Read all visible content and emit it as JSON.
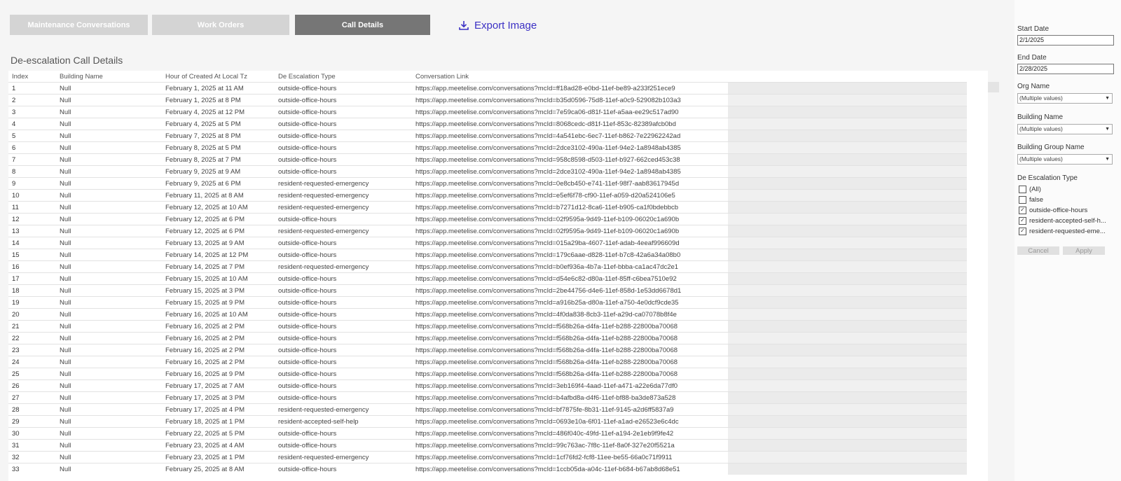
{
  "nav": {
    "buttons": [
      {
        "label": "Maintenance Conversations",
        "active": false
      },
      {
        "label": "Work Orders",
        "active": false
      },
      {
        "label": "Call Details",
        "active": true
      }
    ],
    "export_label": "Export Image"
  },
  "sheet_title": "De-escalation Call Details",
  "table": {
    "columns": [
      "Index",
      "Building Name",
      "Hour of Created At Local Tz",
      "De Escalation Type",
      "Conversation Link"
    ],
    "rows": [
      [
        "1",
        "Null",
        "February 1, 2025 at 11 AM",
        "outside-office-hours",
        "https://app.meetelise.com/conversations?mcId=ff18ad28-e0bd-11ef-be89-a233f251ece9"
      ],
      [
        "2",
        "Null",
        "February 1, 2025 at 8 PM",
        "outside-office-hours",
        "https://app.meetelise.com/conversations?mcId=b35d0596-75d8-11ef-a0c9-529082b103a3"
      ],
      [
        "3",
        "Null",
        "February 4, 2025 at 12 PM",
        "outside-office-hours",
        "https://app.meetelise.com/conversations?mcId=7e59ca06-d81f-11ef-a5aa-ee29c517ad90"
      ],
      [
        "4",
        "Null",
        "February 4, 2025 at 5 PM",
        "outside-office-hours",
        "https://app.meetelise.com/conversations?mcId=8068cedc-d81f-11ef-853c-82389afcb0bd"
      ],
      [
        "5",
        "Null",
        "February 7, 2025 at 8 PM",
        "outside-office-hours",
        "https://app.meetelise.com/conversations?mcId=4a541ebc-6ec7-11ef-b862-7e22962242ad"
      ],
      [
        "6",
        "Null",
        "February 8, 2025 at 5 PM",
        "outside-office-hours",
        "https://app.meetelise.com/conversations?mcId=2dce3102-490a-11ef-94e2-1a8948ab4385"
      ],
      [
        "7",
        "Null",
        "February 8, 2025 at 7 PM",
        "outside-office-hours",
        "https://app.meetelise.com/conversations?mcId=958c8598-d503-11ef-b927-662ced453c38"
      ],
      [
        "8",
        "Null",
        "February 9, 2025 at 9 AM",
        "outside-office-hours",
        "https://app.meetelise.com/conversations?mcId=2dce3102-490a-11ef-94e2-1a8948ab4385"
      ],
      [
        "9",
        "Null",
        "February 9, 2025 at 6 PM",
        "resident-requested-emergency",
        "https://app.meetelise.com/conversations?mcId=0e8cb450-e741-11ef-98f7-aab83617945d"
      ],
      [
        "10",
        "Null",
        "February 11, 2025 at 8 AM",
        "resident-requested-emergency",
        "https://app.meetelise.com/conversations?mcId=e5ef6f78-cf90-11ef-a059-d20a524106e5"
      ],
      [
        "11",
        "Null",
        "February 12, 2025 at 10 AM",
        "resident-requested-emergency",
        "https://app.meetelise.com/conversations?mcId=b7271d12-8ca6-11ef-b905-ca1f0bdebbcb"
      ],
      [
        "12",
        "Null",
        "February 12, 2025 at 6 PM",
        "outside-office-hours",
        "https://app.meetelise.com/conversations?mcId=02f9595a-9d49-11ef-b109-06020c1a690b"
      ],
      [
        "13",
        "Null",
        "February 12, 2025 at 6 PM",
        "resident-requested-emergency",
        "https://app.meetelise.com/conversations?mcId=02f9595a-9d49-11ef-b109-06020c1a690b"
      ],
      [
        "14",
        "Null",
        "February 13, 2025 at 9 AM",
        "outside-office-hours",
        "https://app.meetelise.com/conversations?mcId=015a29ba-4607-11ef-adab-4eeaf996609d"
      ],
      [
        "15",
        "Null",
        "February 14, 2025 at 12 PM",
        "outside-office-hours",
        "https://app.meetelise.com/conversations?mcId=179c6aae-d828-11ef-b7c8-42a6a34a08b0"
      ],
      [
        "16",
        "Null",
        "February 14, 2025 at 7 PM",
        "resident-requested-emergency",
        "https://app.meetelise.com/conversations?mcId=b0ef936a-4b7a-11ef-bbba-ca1ac47dc2e1"
      ],
      [
        "17",
        "Null",
        "February 15, 2025 at 10 AM",
        "outside-office-hours",
        "https://app.meetelise.com/conversations?mcId=d54e6c82-d80a-11ef-85ff-c6bea7510e92"
      ],
      [
        "18",
        "Null",
        "February 15, 2025 at 3 PM",
        "outside-office-hours",
        "https://app.meetelise.com/conversations?mcId=2be44756-d4e6-11ef-858d-1e53dd6678d1"
      ],
      [
        "19",
        "Null",
        "February 15, 2025 at 9 PM",
        "outside-office-hours",
        "https://app.meetelise.com/conversations?mcId=a916b25a-d80a-11ef-a750-4e0dcf9cde35"
      ],
      [
        "20",
        "Null",
        "February 16, 2025 at 10 AM",
        "outside-office-hours",
        "https://app.meetelise.com/conversations?mcId=4f0da838-8cb3-11ef-a29d-ca07078b8f4e"
      ],
      [
        "21",
        "Null",
        "February 16, 2025 at 2 PM",
        "outside-office-hours",
        "https://app.meetelise.com/conversations?mcId=f568b26a-d4fa-11ef-b288-22800ba70068"
      ],
      [
        "22",
        "Null",
        "February 16, 2025 at 2 PM",
        "outside-office-hours",
        "https://app.meetelise.com/conversations?mcId=f568b26a-d4fa-11ef-b288-22800ba70068"
      ],
      [
        "23",
        "Null",
        "February 16, 2025 at 2 PM",
        "outside-office-hours",
        "https://app.meetelise.com/conversations?mcId=f568b26a-d4fa-11ef-b288-22800ba70068"
      ],
      [
        "24",
        "Null",
        "February 16, 2025 at 2 PM",
        "outside-office-hours",
        "https://app.meetelise.com/conversations?mcId=f568b26a-d4fa-11ef-b288-22800ba70068"
      ],
      [
        "25",
        "Null",
        "February 16, 2025 at 9 PM",
        "outside-office-hours",
        "https://app.meetelise.com/conversations?mcId=f568b26a-d4fa-11ef-b288-22800ba70068"
      ],
      [
        "26",
        "Null",
        "February 17, 2025 at 7 AM",
        "outside-office-hours",
        "https://app.meetelise.com/conversations?mcId=3eb169f4-4aad-11ef-a471-a22e6da77df0"
      ],
      [
        "27",
        "Null",
        "February 17, 2025 at 3 PM",
        "outside-office-hours",
        "https://app.meetelise.com/conversations?mcId=b4afbd8a-d4f6-11ef-bf88-ba3de873a528"
      ],
      [
        "28",
        "Null",
        "February 17, 2025 at 4 PM",
        "resident-requested-emergency",
        "https://app.meetelise.com/conversations?mcId=bf7875fe-8b31-11ef-9145-a2d6ff5837a9"
      ],
      [
        "29",
        "Null",
        "February 18, 2025 at 1 PM",
        "resident-accepted-self-help",
        "https://app.meetelise.com/conversations?mcId=0693e10a-6f01-11ef-a1ad-e26523e6c4dc"
      ],
      [
        "30",
        "Null",
        "February 22, 2025 at 5 PM",
        "outside-office-hours",
        "https://app.meetelise.com/conversations?mcId=486f040c-49fd-11ef-a194-2e1eb9f9fe42"
      ],
      [
        "31",
        "Null",
        "February 23, 2025 at 4 AM",
        "outside-office-hours",
        "https://app.meetelise.com/conversations?mcId=99c763ac-7f8c-11ef-8a0f-327e20f5521a"
      ],
      [
        "32",
        "Null",
        "February 23, 2025 at 1 PM",
        "resident-requested-emergency",
        "https://app.meetelise.com/conversations?mcId=1cf76fd2-fcf8-11ee-be55-66a0c71f9911"
      ],
      [
        "33",
        "Null",
        "February 25, 2025 at 8 AM",
        "outside-office-hours",
        "https://app.meetelise.com/conversations?mcId=1ccb05da-a04c-11ef-b684-b67ab8d68e51"
      ]
    ]
  },
  "filters": {
    "start_date": {
      "label": "Start Date",
      "value": "2/1/2025"
    },
    "end_date": {
      "label": "End Date",
      "value": "2/28/2025"
    },
    "org_name": {
      "label": "Org Name",
      "value": "(Multiple values)"
    },
    "building_name": {
      "label": "Building Name",
      "value": "(Multiple values)"
    },
    "building_group_name": {
      "label": "Building Group Name",
      "value": "(Multiple values)"
    },
    "de_escalation_type": {
      "label": "De Escalation Type",
      "options": [
        {
          "label": "(All)",
          "checked": false
        },
        {
          "label": "false",
          "checked": false
        },
        {
          "label": "outside-office-hours",
          "checked": true
        },
        {
          "label": "resident-accepted-self-h...",
          "checked": true
        },
        {
          "label": "resident-requested-eme...",
          "checked": true
        }
      ]
    },
    "cancel_label": "Cancel",
    "apply_label": "Apply"
  },
  "colors": {
    "accent": "#3b30c4",
    "nav_inactive": "#d4d4d4",
    "nav_active": "#767676"
  }
}
